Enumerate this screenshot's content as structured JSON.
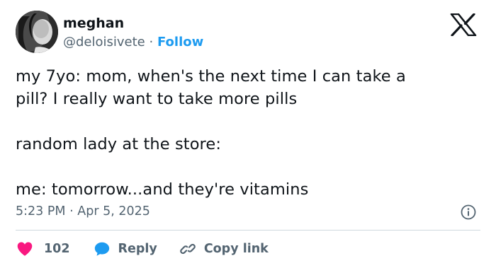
{
  "author": {
    "name": "meghan",
    "handle": "@deloisivete",
    "separator": "·",
    "follow_label": "Follow"
  },
  "tweet": {
    "lines": [
      "my 7yo: mom, when's the next time I can take a",
      "pill? I really want to take more pills",
      "random lady at the store:",
      "me: tomorrow...and they're vitamins"
    ]
  },
  "timestamp": {
    "time": "5:23 PM",
    "separator": "·",
    "date": "Apr 5, 2025"
  },
  "actions": {
    "like_count": "102",
    "reply_label": "Reply",
    "copy_link_label": "Copy link"
  },
  "icons": {
    "logo": "x-logo-icon",
    "info": "info-icon",
    "like": "heart-icon",
    "reply": "speech-bubble-icon",
    "copy_link": "link-icon"
  },
  "colors": {
    "text": "#0f1419",
    "secondary": "#536471",
    "accent": "#1d9bf0",
    "like": "#f91880",
    "divider": "#cfd9de"
  }
}
